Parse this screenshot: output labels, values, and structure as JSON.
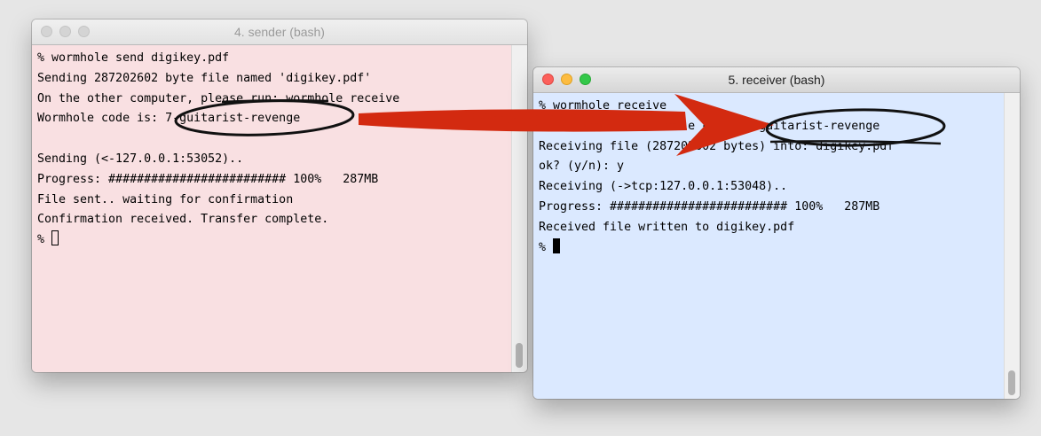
{
  "colors": {
    "sender_bg": "#f9e0e2",
    "receiver_bg": "#dbe9ff",
    "annotation_arrow": "#d32a10",
    "annotation_ellipse": "#111111"
  },
  "sender": {
    "title": "4. sender (bash)",
    "lines": [
      "% wormhole send digikey.pdf",
      "Sending 287202602 byte file named 'digikey.pdf'",
      "On the other computer, please run: wormhole receive",
      "Wormhole code is: 7-guitarist-revenge",
      "",
      "Sending (<-127.0.0.1:53052)..",
      "Progress: ######################### 100%   287MB",
      "File sent.. waiting for confirmation",
      "Confirmation received. Transfer complete."
    ],
    "prompt": "% "
  },
  "receiver": {
    "title": "5. receiver (bash)",
    "lines": [
      "% wormhole receive",
      "Enter receive wormhole code: 7-guitarist-revenge",
      "Receiving file (287202602 bytes) into: digikey.pdf",
      "ok? (y/n): y",
      "Receiving (->tcp:127.0.0.1:53048)..",
      "Progress: ######################### 100%   287MB",
      "Received file written to digikey.pdf"
    ],
    "prompt": "% "
  }
}
